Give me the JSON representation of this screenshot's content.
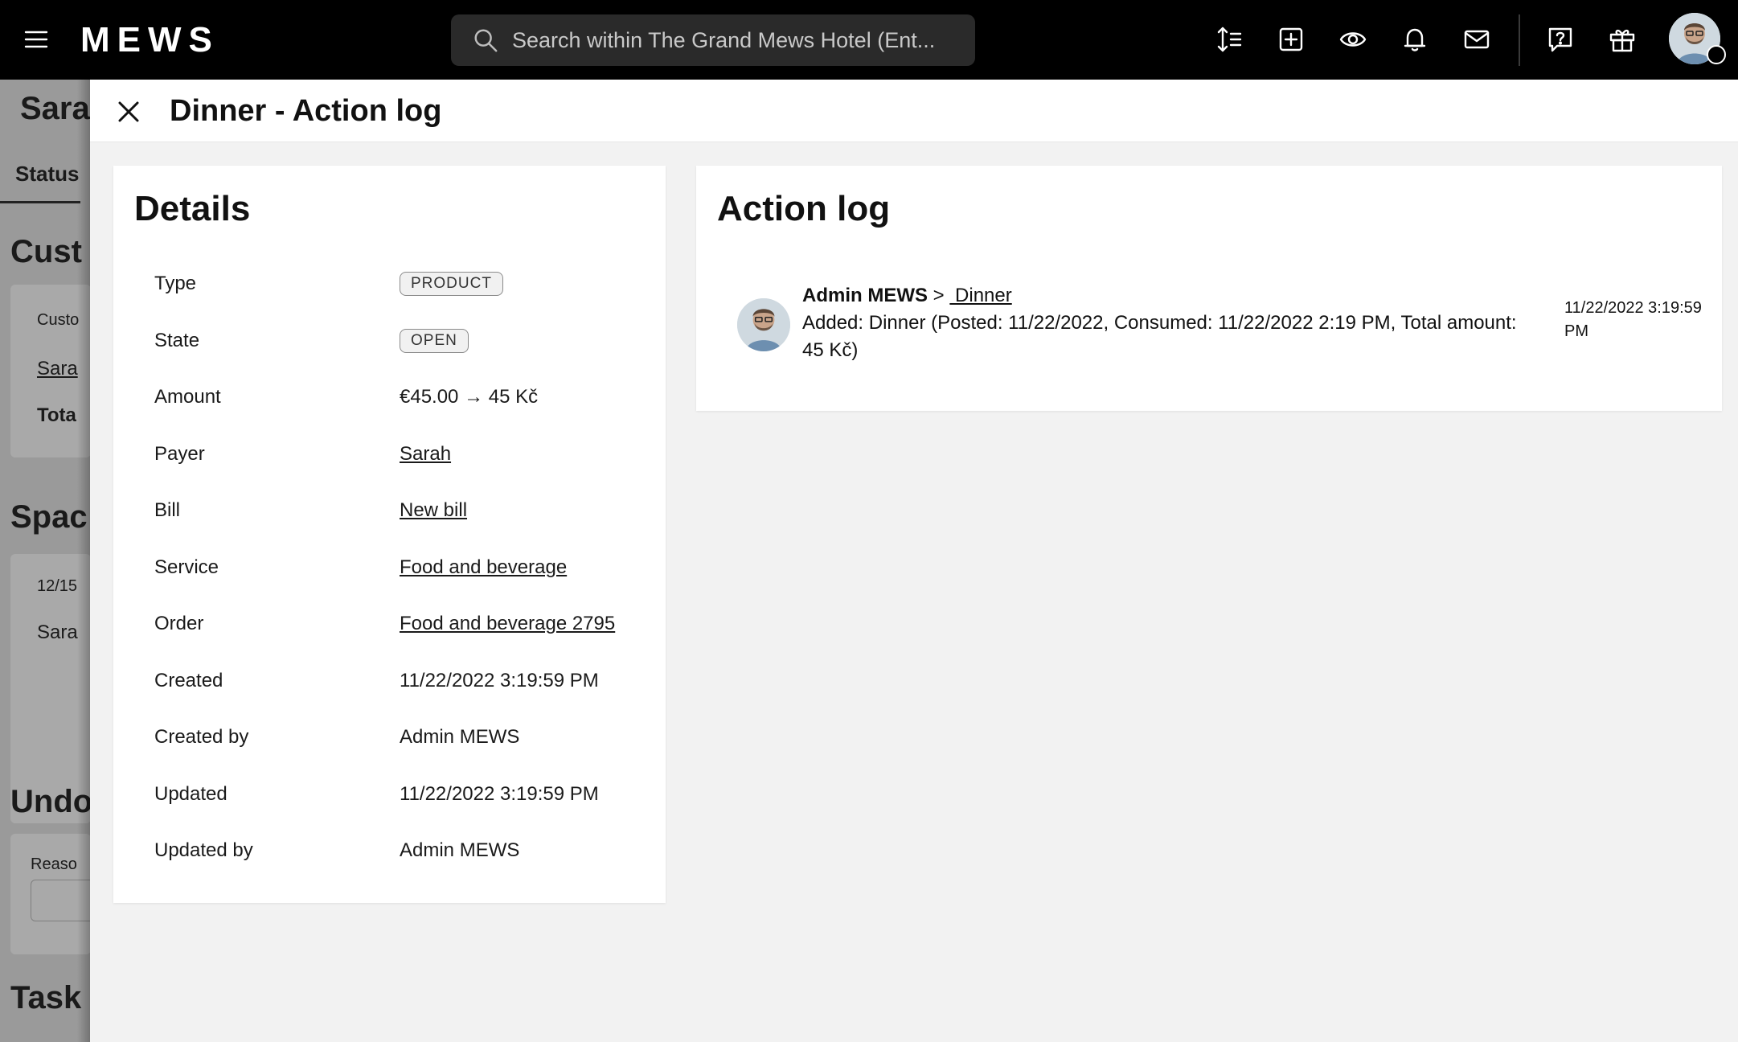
{
  "topbar": {
    "logo": "MEWS",
    "search_placeholder": "Search within The Grand Mews Hotel (Ent...",
    "icons": [
      "menu-icon",
      "sort-icon",
      "add-icon",
      "eye-icon",
      "bell-icon",
      "mail-icon",
      "help-icon",
      "gift-icon",
      "profile-avatar"
    ]
  },
  "background_page": {
    "title": "Sara",
    "tab": "Status",
    "section_customers": "Cust",
    "customer_label": "Custo",
    "customer_link": "Sara",
    "total_label": "Tota",
    "section_spaces": "Spac",
    "space_date": "12/15",
    "space_name": "Sara",
    "section_undo": "Undo",
    "reason_label": "Reaso",
    "section_tasks": "Task"
  },
  "drawer": {
    "title": "Dinner - Action log",
    "details": {
      "heading": "Details",
      "rows": [
        {
          "key": "Type",
          "value": "PRODUCT"
        },
        {
          "key": "State",
          "value": "OPEN"
        },
        {
          "key": "Amount",
          "value": "€45.00 → 45 Kč"
        },
        {
          "key": "Payer",
          "value": "Sarah"
        },
        {
          "key": "Bill",
          "value": "New bill"
        },
        {
          "key": "Service",
          "value": "Food and beverage"
        },
        {
          "key": "Order",
          "value": "Food and beverage 2795"
        },
        {
          "key": "Created",
          "value": "11/22/2022 3:19:59 PM"
        },
        {
          "key": "Created by",
          "value": "Admin MEWS"
        },
        {
          "key": "Updated",
          "value": "11/22/2022 3:19:59 PM"
        },
        {
          "key": "Updated by",
          "value": "Admin MEWS"
        }
      ]
    },
    "action_log": {
      "heading": "Action log",
      "entries": [
        {
          "user": "Admin MEWS",
          "separator": ">",
          "target": " Dinner",
          "text": "Added: Dinner (Posted: 11/22/2022, Consumed: 11/22/2022 2:19 PM, Total amount: 45 Kč)",
          "time": "11/22/2022 3:19:59 PM"
        }
      ]
    }
  }
}
